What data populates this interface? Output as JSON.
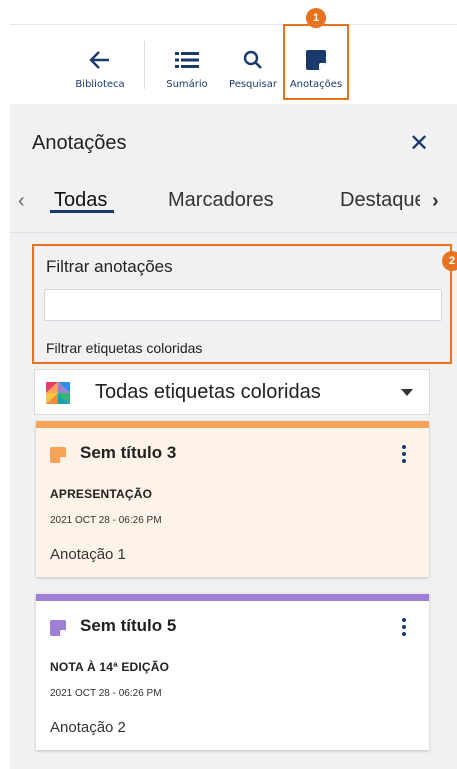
{
  "toolbar": {
    "library_label": "Biblioteca",
    "summary_label": "Sumário",
    "search_label": "Pesquisar",
    "notes_label": "Anotações",
    "callout_1": "1"
  },
  "panel": {
    "title": "Anotações",
    "tabs": [
      {
        "label": "Todas",
        "active": true
      },
      {
        "label": "Marcadores",
        "active": false
      },
      {
        "label": "Destaques",
        "active": false
      }
    ],
    "filter_title": "Filtrar anotações",
    "filter_value": "",
    "filter_tags_label": "Filtrar etiquetas coloridas",
    "callout_2": "2",
    "select_value": "Todas etiquetas coloridas"
  },
  "notes": [
    {
      "title": "Sem título 3",
      "tag": "APRESENTAÇÃO",
      "date": "2021 OCT 28 - 06:26 PM",
      "text": "Anotação 1",
      "color": "#f7a45a"
    },
    {
      "title": "Sem título 5",
      "tag": "NOTA À 14ª EDIÇÃO",
      "date": "2021 OCT 28 - 06:26 PM",
      "text": "Anotação 2",
      "color": "#a07fd6"
    }
  ],
  "colors": {
    "accent": "#e8731e",
    "brand": "#1a3a6b"
  }
}
